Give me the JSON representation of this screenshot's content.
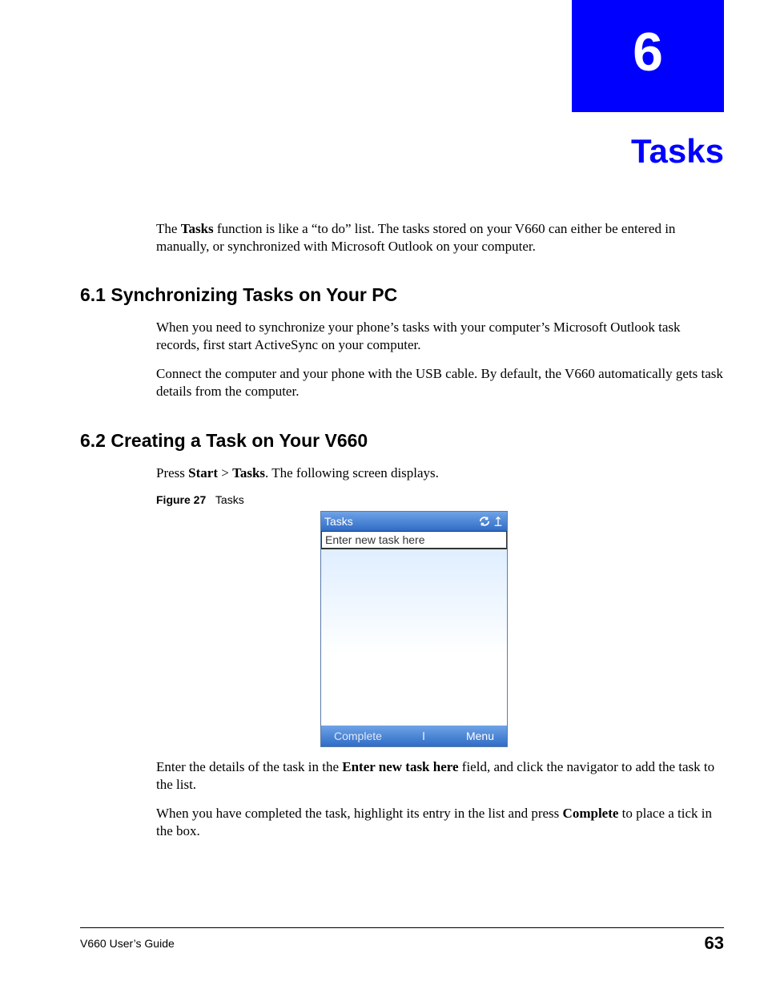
{
  "chapter": {
    "number": "6",
    "title": "Tasks"
  },
  "intro": {
    "bold1": "Tasks",
    "text": " function is like a “to do” list. The tasks stored on your V660 can either be entered in manually, or synchronized with Microsoft Outlook on your computer."
  },
  "section1": {
    "heading": "6.1  Synchronizing Tasks on Your PC",
    "p1": "When you need to synchronize your phone’s tasks with your computer’s Microsoft Outlook task records, first start ActiveSync on your computer.",
    "p2": "Connect the computer and your phone with the USB cable. By default, the V660 automatically gets task details from the computer."
  },
  "section2": {
    "heading": "6.2  Creating a Task on Your V660",
    "p1_a": "Press ",
    "p1_b1": "Start",
    "p1_gt": " > ",
    "p1_b2": "Tasks",
    "p1_c": ". The following screen displays.",
    "p2_a": "Enter the details of the task in the ",
    "p2_b": "Enter new task here",
    "p2_c": " field, and click the navigator to add the task to the list.",
    "p3_a": "When you have completed the task, highlight its entry in the list and press ",
    "p3_b": "Complete",
    "p3_c": " to place a tick in the box."
  },
  "figure": {
    "label": "Figure 27",
    "title": "Tasks"
  },
  "phone": {
    "title": "Tasks",
    "input_placeholder": "Enter new task here",
    "softkey_left": "Complete",
    "softkey_right": "Menu"
  },
  "footer": {
    "guide": "V660 User’s Guide",
    "page": "63"
  }
}
